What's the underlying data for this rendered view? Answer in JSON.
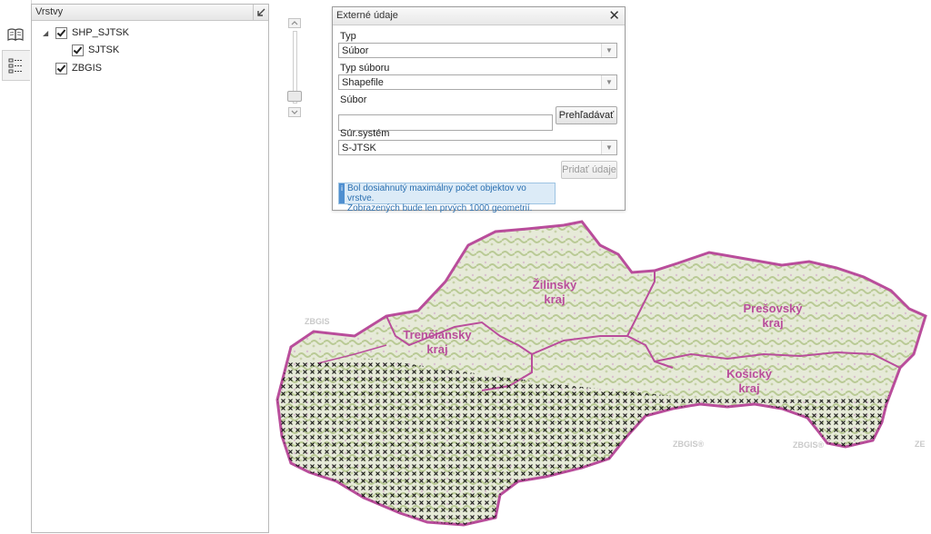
{
  "toolstrip": {
    "book_icon": "book-icon",
    "legend_icon": "legend-list-icon"
  },
  "layers": {
    "title": "Vrstvy",
    "tree": [
      {
        "label": "SHP_SJTSK",
        "checked": true,
        "expanded": true
      },
      {
        "label": "SJTSK",
        "checked": true
      },
      {
        "label": "ZBGIS",
        "checked": true
      }
    ]
  },
  "dialog": {
    "title": "Externé údaje",
    "close": "✕",
    "typ_label": "Typ",
    "typ_value": "Súbor",
    "typ_suboru_label": "Typ súboru",
    "typ_suboru_value": "Shapefile",
    "subor_label": "Súbor",
    "subor_value": "",
    "browse_button": "Prehľadávať",
    "sur_system_label": "Súr.systém",
    "sur_system_value": "S-JTSK",
    "add_button": "Pridať údaje",
    "info_line1": "Bol dosiahnutý maximálny počet objektov vo vrstve.",
    "info_line2": "Zobrazených bude len prvých 1000 geometrií."
  },
  "map": {
    "regions": [
      {
        "name": "Žilinský",
        "suffix": "kraj"
      },
      {
        "name": "Prešovský",
        "suffix": "kraj"
      },
      {
        "name": "Trenčiansky",
        "suffix": "kraj"
      },
      {
        "name": "Košický",
        "suffix": "kraj"
      }
    ],
    "watermarks": [
      "ZBGIS",
      "ZBGIS®",
      "ZBGIS®",
      "ZE"
    ],
    "colors": {
      "border": "#b94d9b",
      "terrain": "#dfe6cf",
      "forest": "#b6c990",
      "marker": "#111111"
    }
  }
}
